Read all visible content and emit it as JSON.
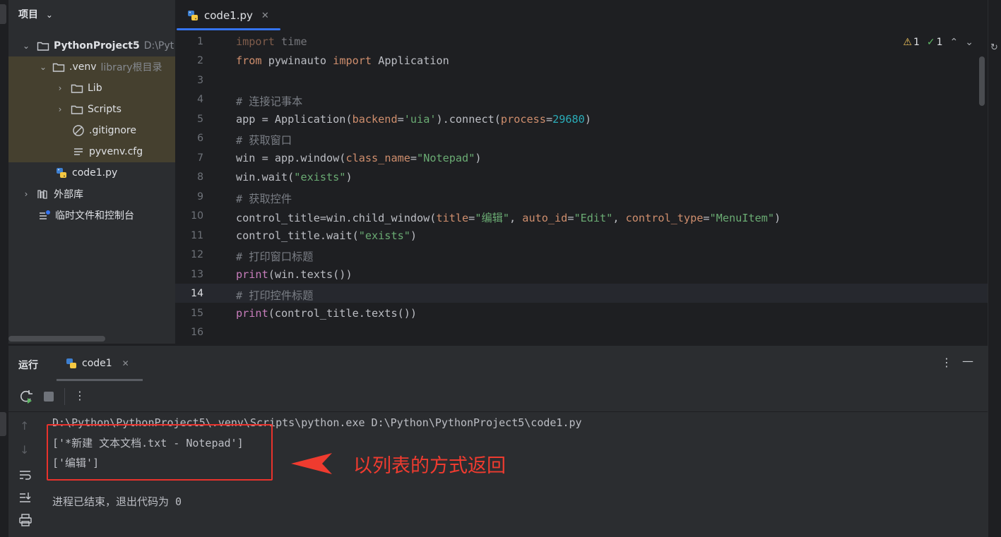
{
  "project_panel": {
    "title": "项目",
    "tree": [
      {
        "label": "PythonProject5",
        "hint": "D:\\Pyt",
        "kind": "folder",
        "level": 0,
        "expanded": true
      },
      {
        "label": ".venv",
        "hint": "library根目录",
        "kind": "folder",
        "level": 1,
        "expanded": true
      },
      {
        "label": "Lib",
        "kind": "folder",
        "level": 2,
        "expanded": false
      },
      {
        "label": "Scripts",
        "kind": "folder",
        "level": 2,
        "expanded": false
      },
      {
        "label": ".gitignore",
        "kind": "ignore-file",
        "level": 2
      },
      {
        "label": "pyvenv.cfg",
        "kind": "text-file",
        "level": 2
      },
      {
        "label": "code1.py",
        "kind": "python-file",
        "level": 1
      },
      {
        "label": "外部库",
        "kind": "library",
        "level": 0,
        "expanded": false
      },
      {
        "label": "临时文件和控制台",
        "kind": "scratches",
        "level": 0
      }
    ]
  },
  "editor": {
    "tab_label": "code1.py",
    "current_line": 14,
    "inspection": {
      "warnings": "1",
      "ok": "1"
    },
    "line_numbers": [
      "1",
      "2",
      "3",
      "4",
      "5",
      "6",
      "7",
      "8",
      "9",
      "10",
      "11",
      "12",
      "13",
      "14",
      "15",
      "16"
    ]
  },
  "code_text": {
    "l1a": "import",
    "l1b": " time",
    "l2a": "from",
    "l2b": " pywinauto ",
    "l2c": "import",
    "l2d": " Application",
    "l4": "# 连接记事本",
    "l5a": "app = Application(",
    "l5b": "backend",
    "l5c": "=",
    "l5d": "'uia'",
    "l5e": ").connect(",
    "l5f": "process",
    "l5g": "=",
    "l5h": "29680",
    "l5i": ")",
    "l6": "# 获取窗口",
    "l7a": "win = app.window(",
    "l7b": "class_name",
    "l7c": "=",
    "l7d": "\"Notepad\"",
    "l7e": ")",
    "l8a": "win.wait(",
    "l8b": "\"exists\"",
    "l8c": ")",
    "l9": "# 获取控件",
    "l10a": "control_title=win.child_window(",
    "l10b": "title",
    "l10c": "=",
    "l10d": "\"编辑\"",
    "l10e": ", ",
    "l10f": "auto_id",
    "l10g": "=",
    "l10h": "\"Edit\"",
    "l10i": ", ",
    "l10j": "control_type",
    "l10k": "=",
    "l10l": "\"MenuItem\"",
    "l10m": ")",
    "l11a": "control_title.wait(",
    "l11b": "\"exists\"",
    "l11c": ")",
    "l12": "# 打印窗口标题",
    "l13a": "print",
    "l13b": "(win.texts())",
    "l14": "# 打印控件标题",
    "l15a": "print",
    "l15b": "(control_title.texts())"
  },
  "run_panel": {
    "title": "运行",
    "tab_label": "code1",
    "console": [
      "D:\\Python\\PythonProject5\\.venv\\Scripts\\python.exe D:\\Python\\PythonProject5\\code1.py",
      "['*新建 文本文档.txt - Notepad']",
      "['编辑']",
      "",
      "进程已结束，退出代码为 0"
    ]
  },
  "annotation": {
    "text": "以列表的方式返回",
    "color": "#ef3b2f"
  },
  "colors": {
    "accent": "#3574f0",
    "keyword": "#cf8e6d",
    "string": "#6aab73",
    "comment": "#7a7e85",
    "number": "#2aacb8",
    "param": "#b3ae60",
    "builtin": "#c77dbb"
  }
}
